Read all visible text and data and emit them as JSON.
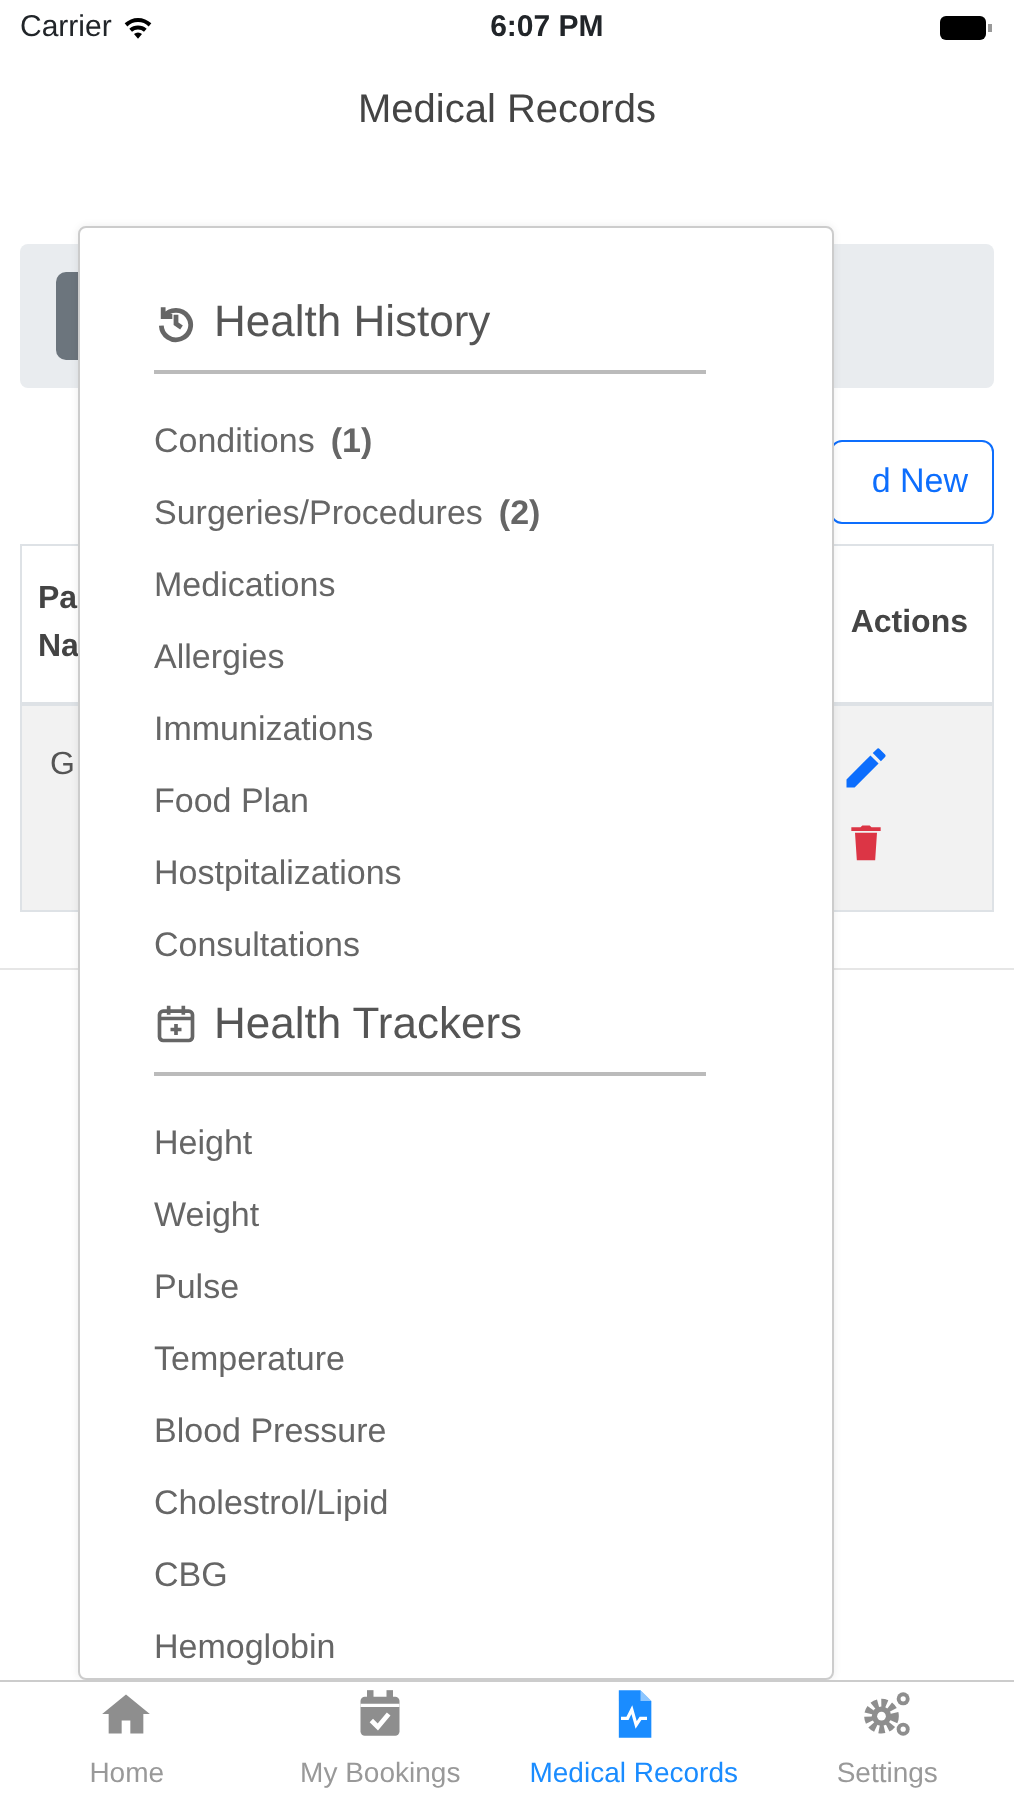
{
  "status_bar": {
    "carrier": "Carrier",
    "time": "6:07 PM"
  },
  "header": {
    "title": "Medical Records"
  },
  "add_button": {
    "label": "d New"
  },
  "table": {
    "columns": [
      {
        "lines": [
          "Pa",
          "Na"
        ]
      },
      {
        "lines": [
          "Actions"
        ]
      }
    ],
    "rows": [
      {
        "cells": [
          "G"
        ]
      }
    ]
  },
  "menu": {
    "sections": [
      {
        "kind": "history",
        "title": "Health History",
        "items": [
          {
            "label": "Conditions",
            "count": "(1)"
          },
          {
            "label": "Surgeries/Procedures",
            "count": "(2)"
          },
          {
            "label": "Medications"
          },
          {
            "label": "Allergies"
          },
          {
            "label": "Immunizations"
          },
          {
            "label": "Food Plan"
          },
          {
            "label": "Hostpitalizations"
          },
          {
            "label": "Consultations"
          }
        ]
      },
      {
        "kind": "trackers",
        "title": "Health Trackers",
        "items": [
          {
            "label": "Height"
          },
          {
            "label": "Weight"
          },
          {
            "label": "Pulse"
          },
          {
            "label": "Temperature"
          },
          {
            "label": "Blood Pressure"
          },
          {
            "label": "Cholestrol/Lipid"
          },
          {
            "label": "CBG"
          },
          {
            "label": "Hemoglobin"
          }
        ]
      }
    ]
  },
  "tab_bar": [
    {
      "kind": "home",
      "label": "Home",
      "selected": false
    },
    {
      "kind": "bookings",
      "label": "My Bookings",
      "selected": false
    },
    {
      "kind": "records",
      "label": "Medical Records",
      "selected": true
    },
    {
      "kind": "settings",
      "label": "Settings",
      "selected": false
    }
  ]
}
